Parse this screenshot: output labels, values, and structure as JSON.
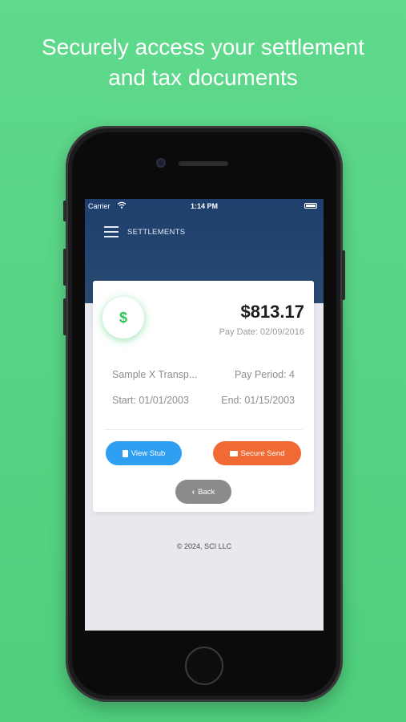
{
  "promo": {
    "line1": "Securely access your settlement",
    "line2": "and tax documents"
  },
  "status_bar": {
    "carrier": "Carrier",
    "time": "1:14 PM"
  },
  "nav": {
    "title": "SETTLEMENTS"
  },
  "card": {
    "currency_icon": "$",
    "amount": "$813.17",
    "pay_date": "Pay Date: 02/09/2016",
    "company": "Sample X Transp...",
    "pay_period": "Pay Period: 4",
    "start": "Start: 01/01/2003",
    "end": "End: 01/15/2003",
    "view_stub_label": "View Stub",
    "secure_send_label": "Secure Send",
    "back_label": "Back"
  },
  "footer": {
    "copyright": "© 2024, SCI LLC"
  },
  "colors": {
    "background": "#56d584",
    "header": "#1f3f6e",
    "view_stub": "#2f9ff2",
    "secure_send": "#f26a33",
    "back": "#8b8b8d",
    "dollar": "#2cc35b"
  }
}
